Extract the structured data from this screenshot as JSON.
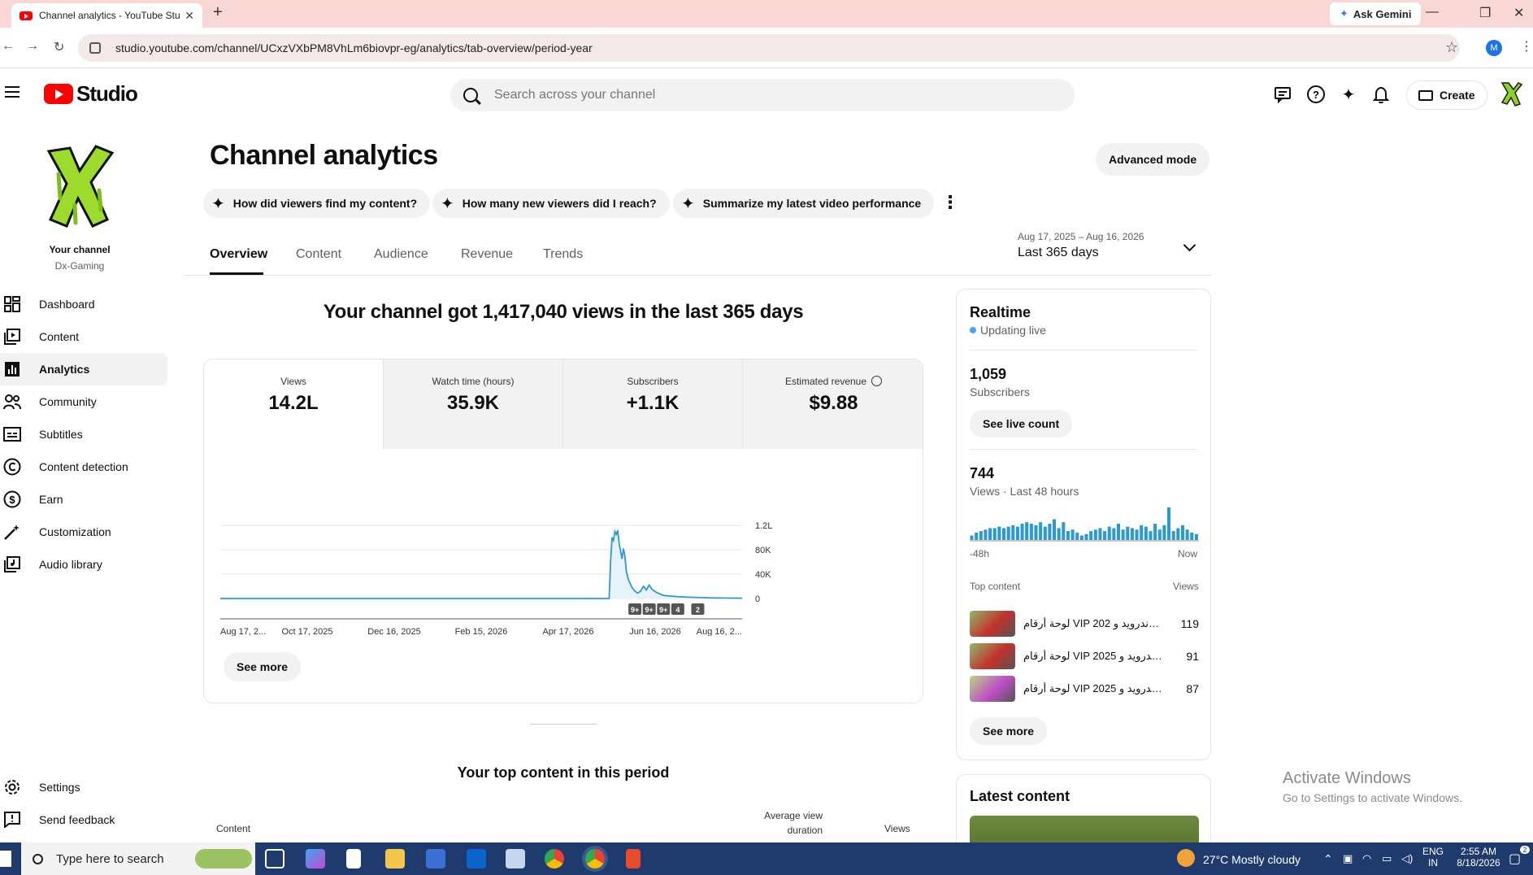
{
  "browser": {
    "tab_title": "Channel analytics - YouTube Studio",
    "new_tab": "+",
    "ask_gemini": "Ask Gemini",
    "url": "studio.youtube.com/channel/UCxzVXbPM8VhLm6biovpr-eg/analytics/tab-overview/period-year",
    "profile_initial": "M"
  },
  "header": {
    "logo_text": "Studio",
    "search_placeholder": "Search across your channel",
    "create_label": "Create"
  },
  "sidebar": {
    "your_channel": "Your channel",
    "channel_name": "Dx-Gaming",
    "items": [
      {
        "label": "Dashboard",
        "icon": "dashboard-icon"
      },
      {
        "label": "Content",
        "icon": "content-icon"
      },
      {
        "label": "Analytics",
        "icon": "analytics-icon",
        "active": true
      },
      {
        "label": "Community",
        "icon": "community-icon"
      },
      {
        "label": "Subtitles",
        "icon": "subtitles-icon"
      },
      {
        "label": "Content detection",
        "icon": "copyright-icon"
      },
      {
        "label": "Earn",
        "icon": "earn-icon"
      },
      {
        "label": "Customization",
        "icon": "customization-icon"
      },
      {
        "label": "Audio library",
        "icon": "audio-library-icon"
      }
    ],
    "settings": "Settings",
    "send_feedback": "Send feedback"
  },
  "main": {
    "title": "Channel analytics",
    "advanced_mode": "Advanced mode",
    "chips": [
      "How did viewers find my content?",
      "How many new viewers did I reach?",
      "Summarize my latest video performance"
    ],
    "tabs": [
      "Overview",
      "Content",
      "Audience",
      "Revenue",
      "Trends"
    ],
    "date_range": "Aug 17, 2025 – Aug 16, 2026",
    "period": "Last 365 days",
    "headline": "Your channel got 1,417,040 views in the last 365 days",
    "metrics": [
      {
        "label": "Views",
        "value": "14.2L"
      },
      {
        "label": "Watch time (hours)",
        "value": "35.9K"
      },
      {
        "label": "Subscribers",
        "value": "+1.1K"
      },
      {
        "label": "Estimated revenue",
        "value": "$9.88"
      }
    ],
    "see_more": "See more",
    "top_content_title": "Your top content in this period",
    "table_headers": {
      "content": "Content",
      "avg_duration": "Average view duration",
      "views": "Views"
    }
  },
  "chart_data": {
    "type": "area",
    "x_tick_labels": [
      "Aug 17, 2...",
      "Oct 17, 2025",
      "Dec 16, 2025",
      "Feb 15, 2026",
      "Apr 17, 2026",
      "Jun 16, 2026",
      "Aug 16, 2..."
    ],
    "y_tick_labels": [
      "1.2L",
      "80K",
      "40K",
      "0"
    ],
    "y_ticks_value": [
      120000,
      80000,
      40000,
      0
    ],
    "ylim": [
      0,
      120000
    ],
    "x_range_days": [
      0,
      365
    ],
    "series": [
      {
        "x_days": [
          0,
          60,
          120,
          180,
          240,
          272,
          273,
          274,
          275,
          276,
          277,
          278,
          279,
          280,
          281,
          282,
          283,
          284,
          285,
          286,
          288,
          290,
          292,
          294,
          296,
          298,
          300,
          302,
          305,
          310,
          320,
          330,
          345,
          365
        ],
        "values": [
          0,
          0,
          0,
          0,
          0,
          0,
          60000,
          100000,
          95000,
          110000,
          105000,
          112000,
          90000,
          78000,
          65000,
          82000,
          70000,
          45000,
          35000,
          28000,
          18000,
          12000,
          9000,
          12000,
          20000,
          14000,
          22000,
          15000,
          10000,
          5000,
          3000,
          2000,
          1000,
          500
        ]
      }
    ],
    "markers": [
      "9+",
      "9+",
      "9+",
      "4",
      "2"
    ],
    "marker_days": [
      290,
      300,
      310,
      320,
      334
    ]
  },
  "realtime": {
    "title": "Realtime",
    "status": "Updating live",
    "subscribers_value": "1,059",
    "subscribers_label": "Subscribers",
    "see_live_count": "See live count",
    "views_value": "744",
    "views_label": "Views · Last 48 hours",
    "bars": [
      3,
      5,
      6,
      7,
      8,
      8,
      9,
      8,
      9,
      10,
      9,
      11,
      12,
      11,
      10,
      12,
      9,
      11,
      14,
      8,
      12,
      6,
      7,
      5,
      3,
      4,
      6,
      7,
      8,
      6,
      9,
      8,
      11,
      7,
      9,
      8,
      7,
      10,
      9,
      6,
      11,
      7,
      10,
      22,
      6,
      8,
      10,
      7,
      5,
      4
    ],
    "axis_start": "-48h",
    "axis_end": "Now",
    "top_content_label": "Top content",
    "views_col": "Views",
    "top_content": [
      {
        "title": "لوحة أرقام VIP لأندرويد و 202...",
        "views": "119"
      },
      {
        "title": "لوحة أرقام VIP لأندرويد و 2025 ...",
        "views": "91"
      },
      {
        "title": "لوحة أرقام VIP لأندرويد و 2025 ...",
        "views": "87"
      }
    ],
    "see_more": "See more",
    "latest_content": "Latest content"
  },
  "watermark": {
    "line1": "Activate Windows",
    "line2": "Go to Settings to activate Windows."
  },
  "taskbar": {
    "search_placeholder": "Type here to search",
    "weather": "27°C  Mostly cloudy",
    "lang1": "ENG",
    "lang2": "IN",
    "time": "2:55 AM",
    "date": "8/18/2026",
    "notification_count": "2"
  },
  "colors": {
    "accent": "#065fd4",
    "chart_line": "#2c9ad1",
    "youtube_red": "#ff0000"
  }
}
